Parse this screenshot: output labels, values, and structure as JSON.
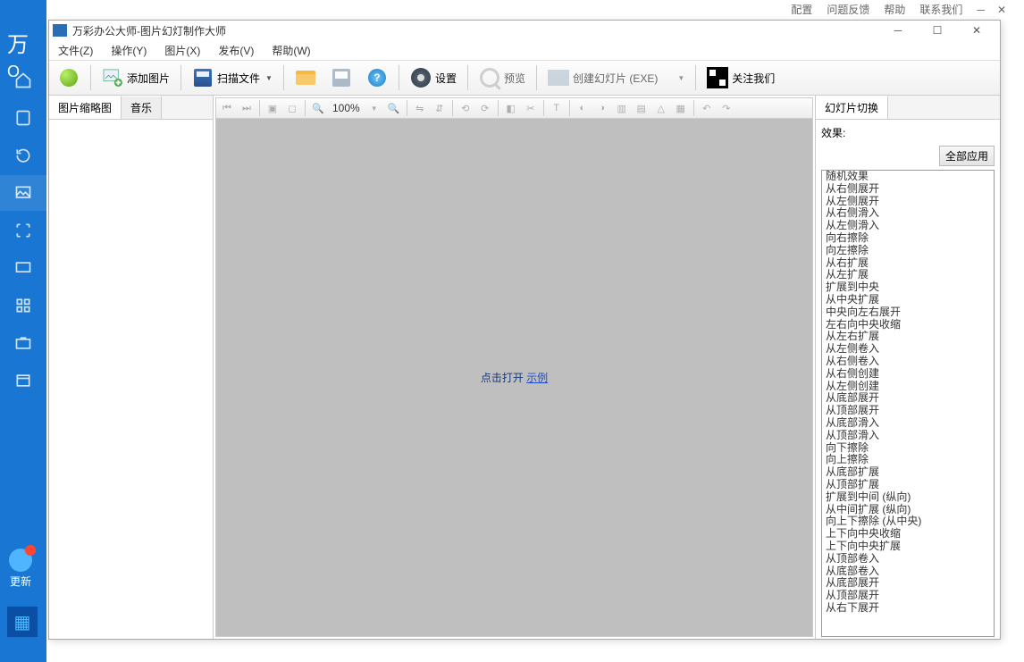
{
  "bg": {
    "logo": "万\nO",
    "topmenu": [
      "配置",
      "问题反馈",
      "帮助",
      "联系我们"
    ],
    "update": "更新"
  },
  "titlebar": "万彩办公大师-图片幻灯制作大师",
  "menus": [
    "文件(Z)",
    "操作(Y)",
    "图片(X)",
    "发布(V)",
    "帮助(W)"
  ],
  "toolbar": {
    "addImage": "添加图片",
    "scan": "扫描文件",
    "settings": "设置",
    "preview": "预览",
    "create": "创建幻灯片 (EXE)",
    "follow": "关注我们"
  },
  "leftTabs": {
    "thumb": "图片缩略图",
    "music": "音乐"
  },
  "miniToolbar": {
    "zoom": "100%"
  },
  "canvas": {
    "msg": "点击打开 ",
    "link": "示例"
  },
  "rightPanel": {
    "tab": "幻灯片切换",
    "effectLabel": "效果:",
    "applyAll": "全部应用",
    "effects": [
      "随机效果",
      "从右侧展开",
      "从左侧展开",
      "从右侧滑入",
      "从左侧滑入",
      "向右擦除",
      "向左擦除",
      "从右扩展",
      "从左扩展",
      "扩展到中央",
      "从中央扩展",
      "中央向左右展开",
      "左右向中央收缩",
      "从左右扩展",
      "从左侧卷入",
      "从右侧卷入",
      "从右侧创建",
      "从左侧创建",
      "从底部展开",
      "从顶部展开",
      "从底部滑入",
      "从顶部滑入",
      "向下擦除",
      "向上擦除",
      "从底部扩展",
      "从顶部扩展",
      "扩展到中间 (纵向)",
      "从中间扩展 (纵向)",
      "向上下擦除 (从中央)",
      "上下向中央收缩",
      "上下向中央扩展",
      "从顶部卷入",
      "从底部卷入",
      "从底部展开",
      "从顶部展开",
      "从右下展开"
    ]
  }
}
